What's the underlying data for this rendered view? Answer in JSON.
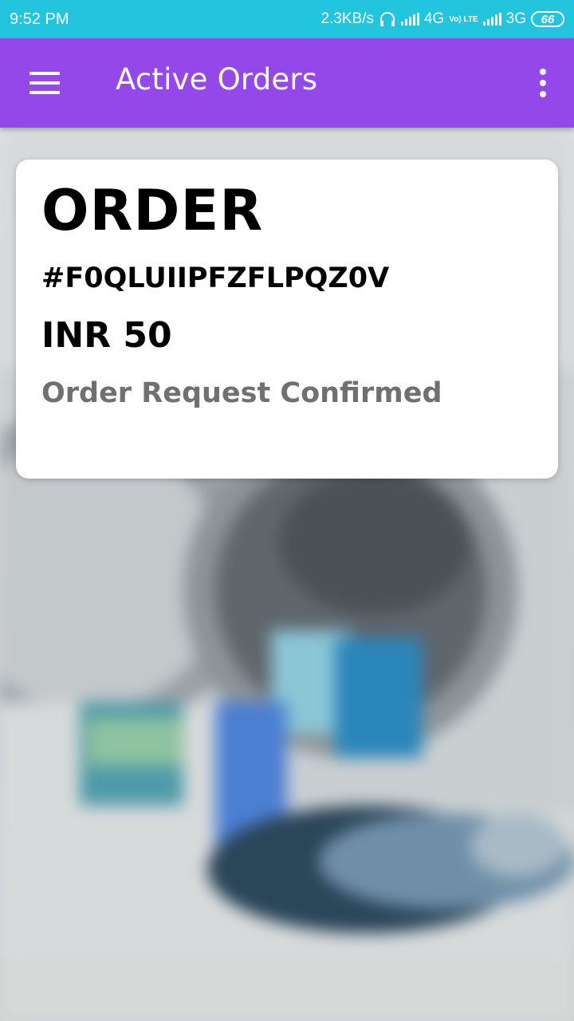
{
  "status_bar": {
    "time": "9:52 PM",
    "net_speed": "2.3KB/s",
    "network_1": "4G",
    "volte": "Vo) LTE",
    "network_2": "3G",
    "battery": "66"
  },
  "app_bar": {
    "title": "Active Orders",
    "menu_icon": "hamburger-menu-icon",
    "overflow_icon": "more-vertical-icon",
    "color": "#9448ea"
  },
  "order": {
    "heading": "ORDER",
    "id": "#F0QLUIIPFZFLPQZ0V",
    "amount": "INR 50",
    "status": "Order Request Confirmed"
  },
  "colors": {
    "status_bar": "#22c4de",
    "status_text": "#707070"
  }
}
